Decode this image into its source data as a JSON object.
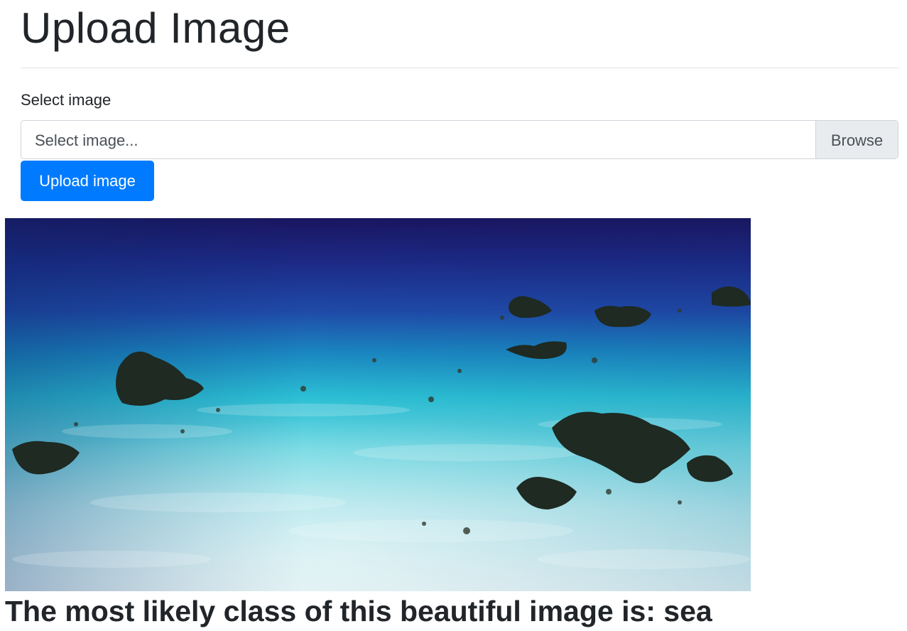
{
  "page": {
    "title": "Upload Image"
  },
  "form": {
    "label": "Select image",
    "file_input": {
      "placeholder": "Select image...",
      "browse_label": "Browse"
    },
    "submit_label": "Upload image"
  },
  "preview": {
    "image_name": "underwater-sea-floor-photo"
  },
  "result": {
    "text": "The most likely class of this beautiful image is: sea"
  },
  "colors": {
    "primary": "#007bff",
    "browse_bg": "#e9ecef",
    "text": "#212529"
  }
}
